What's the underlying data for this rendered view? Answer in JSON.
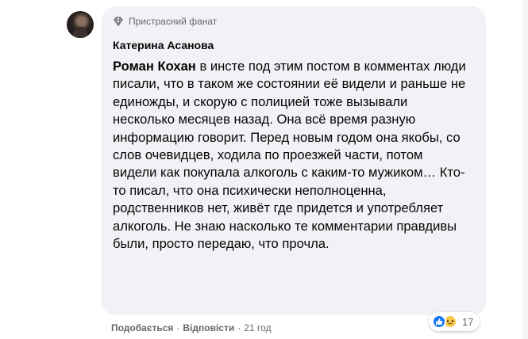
{
  "comment": {
    "badge": {
      "icon": "diamond-icon",
      "label": "Пристрасний фанат"
    },
    "author": "Катерина Асанова",
    "mention": "Роман Кохан",
    "text": " в инсте под этим постом в комментах люди писали, что в таком же состоянии её видели и раньше не единожды, и скорую с полицией тоже вызывали несколько месяцев назад. Она всё время разную информацию говорит. Перед новым годом она якобы, со слов очевидцев, ходила по проезжей части, потом видели как покупала алкоголь с каким-то мужиком… Кто-то писал, что она психически неполноценна, родственников нет, живёт где придется и употребляет алкоголь. Не знаю насколько те комментарии правдивы были, просто передаю, что прочла.",
    "actions": {
      "like": "Подобається",
      "reply": "Відповісти",
      "separator": "·",
      "time": "21 год"
    },
    "reactions": {
      "icons": [
        "like-icon",
        "sad-icon"
      ],
      "count": "17"
    }
  },
  "colors": {
    "bubble": "#f0f2f5",
    "text": "#050505",
    "secondary": "#65676b",
    "like_blue": "#1877f2",
    "sad_yellow": "#f7c94b"
  }
}
